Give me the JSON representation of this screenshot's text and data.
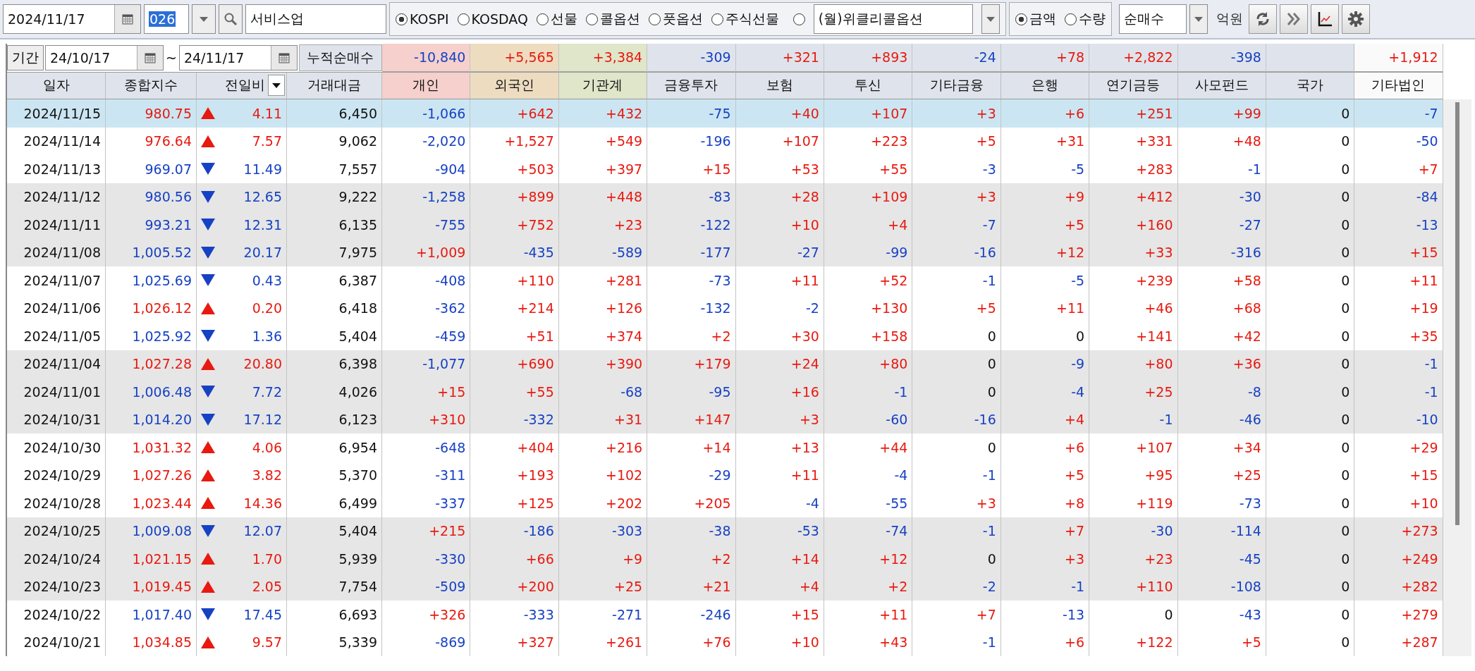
{
  "toolbar": {
    "date": "2024/11/17",
    "code": "026",
    "name": "서비스업",
    "markets": [
      {
        "kind": "radio",
        "label": "KOSPI",
        "selected": true
      },
      {
        "kind": "radio",
        "label": "KOSDAQ",
        "selected": false
      },
      {
        "kind": "radio",
        "label": "선물",
        "selected": false
      },
      {
        "kind": "radio",
        "label": "콜옵션",
        "selected": false
      },
      {
        "kind": "radio",
        "label": "풋옵션",
        "selected": false
      },
      {
        "kind": "radio",
        "label": "주식선물",
        "selected": false
      },
      {
        "kind": "dropdown",
        "label": "(월)위클리콜옵션",
        "selected": false
      }
    ],
    "measures": [
      {
        "label": "금액",
        "selected": true
      },
      {
        "label": "수량",
        "selected": false
      }
    ],
    "mode": "순매수",
    "unit": "억원"
  },
  "period": {
    "button": "기간",
    "from": "24/10/17",
    "separator": "~",
    "to": "24/11/17",
    "label": "누적순매수",
    "totals": [
      {
        "kind": "value",
        "value": "-10,840"
      },
      {
        "kind": "value",
        "value": "+5,565"
      },
      {
        "kind": "value",
        "value": "+3,384"
      },
      {
        "kind": "value",
        "value": "-309"
      },
      {
        "kind": "value",
        "value": "+321"
      },
      {
        "kind": "value",
        "value": "+893"
      },
      {
        "kind": "value",
        "value": "-24"
      },
      {
        "kind": "value",
        "value": "+78"
      },
      {
        "kind": "value",
        "value": "+2,822"
      },
      {
        "kind": "value",
        "value": "-398"
      },
      {
        "kind": "empty"
      },
      {
        "kind": "value",
        "value": "+1,912"
      }
    ]
  },
  "columns": [
    {
      "label": "일자",
      "kind": "plain",
      "color": "#dfe4ec"
    },
    {
      "label": "종합지수",
      "kind": "plain",
      "color": "#dfe4ec"
    },
    {
      "label": "전일비",
      "kind": "menu",
      "color": "#dfe4ec"
    },
    {
      "label": "거래대금",
      "kind": "plain",
      "color": "#dfe4ec"
    },
    {
      "label": "개인",
      "kind": "plain",
      "color": "#f5d0cc"
    },
    {
      "label": "외국인",
      "kind": "plain",
      "color": "#eddcc0"
    },
    {
      "label": "기관계",
      "kind": "plain",
      "color": "#dfe6c9"
    },
    {
      "label": "금융투자",
      "kind": "plain",
      "color": "#dfe4ec"
    },
    {
      "label": "보험",
      "kind": "plain",
      "color": "#dfe4ec"
    },
    {
      "label": "투신",
      "kind": "plain",
      "color": "#dfe4ec"
    },
    {
      "label": "기타금융",
      "kind": "plain",
      "color": "#dfe4ec"
    },
    {
      "label": "은행",
      "kind": "plain",
      "color": "#dfe4ec"
    },
    {
      "label": "연기금등",
      "kind": "plain",
      "color": "#dfe4ec"
    },
    {
      "label": "사모펀드",
      "kind": "plain",
      "color": "#dfe4ec"
    },
    {
      "label": "국가",
      "kind": "plain",
      "color": "#dfe4ec"
    },
    {
      "label": "기타법인",
      "kind": "plain",
      "color": "#fafafa"
    }
  ],
  "rows": [
    {
      "date": "2024/11/15",
      "index": "980.75",
      "rising": true,
      "change": "4.11",
      "amount": "6,450",
      "selected": true,
      "values": [
        "-1,066",
        "+642",
        "+432",
        "-75",
        "+40",
        "+107",
        "+3",
        "+6",
        "+251",
        "+99",
        "0",
        "-7"
      ]
    },
    {
      "date": "2024/11/14",
      "index": "976.64",
      "rising": true,
      "change": "7.57",
      "amount": "9,062",
      "selected": false,
      "values": [
        "-2,020",
        "+1,527",
        "+549",
        "-196",
        "+107",
        "+223",
        "+5",
        "+31",
        "+331",
        "+48",
        "0",
        "-50"
      ]
    },
    {
      "date": "2024/11/13",
      "index": "969.07",
      "rising": false,
      "change": "11.49",
      "amount": "7,557",
      "selected": false,
      "values": [
        "-904",
        "+503",
        "+397",
        "+15",
        "+53",
        "+55",
        "-3",
        "-5",
        "+283",
        "-1",
        "0",
        "+7"
      ]
    },
    {
      "date": "2024/11/12",
      "index": "980.56",
      "rising": false,
      "change": "12.65",
      "amount": "9,222",
      "selected": false,
      "values": [
        "-1,258",
        "+899",
        "+448",
        "-83",
        "+28",
        "+109",
        "+3",
        "+9",
        "+412",
        "-30",
        "0",
        "-84"
      ]
    },
    {
      "date": "2024/11/11",
      "index": "993.21",
      "rising": false,
      "change": "12.31",
      "amount": "6,135",
      "selected": false,
      "values": [
        "-755",
        "+752",
        "+23",
        "-122",
        "+10",
        "+4",
        "-7",
        "+5",
        "+160",
        "-27",
        "0",
        "-13"
      ]
    },
    {
      "date": "2024/11/08",
      "index": "1,005.52",
      "rising": false,
      "change": "20.17",
      "amount": "7,975",
      "selected": false,
      "values": [
        "+1,009",
        "-435",
        "-589",
        "-177",
        "-27",
        "-99",
        "-16",
        "+12",
        "+33",
        "-316",
        "0",
        "+15"
      ]
    },
    {
      "date": "2024/11/07",
      "index": "1,025.69",
      "rising": false,
      "change": "0.43",
      "amount": "6,387",
      "selected": false,
      "values": [
        "-408",
        "+110",
        "+281",
        "-73",
        "+11",
        "+52",
        "-1",
        "-5",
        "+239",
        "+58",
        "0",
        "+11"
      ]
    },
    {
      "date": "2024/11/06",
      "index": "1,026.12",
      "rising": true,
      "change": "0.20",
      "amount": "6,418",
      "selected": false,
      "values": [
        "-362",
        "+214",
        "+126",
        "-132",
        "-2",
        "+130",
        "+5",
        "+11",
        "+46",
        "+68",
        "0",
        "+19"
      ]
    },
    {
      "date": "2024/11/05",
      "index": "1,025.92",
      "rising": false,
      "change": "1.36",
      "amount": "5,404",
      "selected": false,
      "values": [
        "-459",
        "+51",
        "+374",
        "+2",
        "+30",
        "+158",
        "0",
        "0",
        "+141",
        "+42",
        "0",
        "+35"
      ]
    },
    {
      "date": "2024/11/04",
      "index": "1,027.28",
      "rising": true,
      "change": "20.80",
      "amount": "6,398",
      "selected": false,
      "values": [
        "-1,077",
        "+690",
        "+390",
        "+179",
        "+24",
        "+80",
        "0",
        "-9",
        "+80",
        "+36",
        "0",
        "-1"
      ]
    },
    {
      "date": "2024/11/01",
      "index": "1,006.48",
      "rising": false,
      "change": "7.72",
      "amount": "4,026",
      "selected": false,
      "values": [
        "+15",
        "+55",
        "-68",
        "-95",
        "+16",
        "-1",
        "0",
        "-4",
        "+25",
        "-8",
        "0",
        "-1"
      ]
    },
    {
      "date": "2024/10/31",
      "index": "1,014.20",
      "rising": false,
      "change": "17.12",
      "amount": "6,123",
      "selected": false,
      "values": [
        "+310",
        "-332",
        "+31",
        "+147",
        "+3",
        "-60",
        "-16",
        "+4",
        "-1",
        "-46",
        "0",
        "-10"
      ]
    },
    {
      "date": "2024/10/30",
      "index": "1,031.32",
      "rising": true,
      "change": "4.06",
      "amount": "6,954",
      "selected": false,
      "values": [
        "-648",
        "+404",
        "+216",
        "+14",
        "+13",
        "+44",
        "0",
        "+6",
        "+107",
        "+34",
        "0",
        "+29"
      ]
    },
    {
      "date": "2024/10/29",
      "index": "1,027.26",
      "rising": true,
      "change": "3.82",
      "amount": "5,370",
      "selected": false,
      "values": [
        "-311",
        "+193",
        "+102",
        "-29",
        "+11",
        "-4",
        "-1",
        "+5",
        "+95",
        "+25",
        "0",
        "+15"
      ]
    },
    {
      "date": "2024/10/28",
      "index": "1,023.44",
      "rising": true,
      "change": "14.36",
      "amount": "6,499",
      "selected": false,
      "values": [
        "-337",
        "+125",
        "+202",
        "+205",
        "-4",
        "-55",
        "+3",
        "+8",
        "+119",
        "-73",
        "0",
        "+10"
      ]
    },
    {
      "date": "2024/10/25",
      "index": "1,009.08",
      "rising": false,
      "change": "12.07",
      "amount": "5,404",
      "selected": false,
      "values": [
        "+215",
        "-186",
        "-303",
        "-38",
        "-53",
        "-74",
        "-1",
        "+7",
        "-30",
        "-114",
        "0",
        "+273"
      ]
    },
    {
      "date": "2024/10/24",
      "index": "1,021.15",
      "rising": true,
      "change": "1.70",
      "amount": "5,939",
      "selected": false,
      "values": [
        "-330",
        "+66",
        "+9",
        "+2",
        "+14",
        "+12",
        "0",
        "+3",
        "+23",
        "-45",
        "0",
        "+249"
      ]
    },
    {
      "date": "2024/10/23",
      "index": "1,019.45",
      "rising": true,
      "change": "2.05",
      "amount": "7,754",
      "selected": false,
      "values": [
        "-509",
        "+200",
        "+25",
        "+21",
        "+4",
        "+2",
        "-2",
        "-1",
        "+110",
        "-108",
        "0",
        "+282"
      ]
    },
    {
      "date": "2024/10/22",
      "index": "1,017.40",
      "rising": false,
      "change": "17.45",
      "amount": "6,693",
      "selected": false,
      "values": [
        "+326",
        "-333",
        "-271",
        "-246",
        "+15",
        "+11",
        "+7",
        "-13",
        "0",
        "-43",
        "0",
        "+279"
      ]
    },
    {
      "date": "2024/10/21",
      "index": "1,034.85",
      "rising": true,
      "change": "9.57",
      "amount": "5,339",
      "selected": false,
      "values": [
        "-869",
        "+327",
        "+261",
        "+76",
        "+10",
        "+43",
        "-1",
        "+6",
        "+122",
        "+5",
        "0",
        "+287"
      ]
    }
  ]
}
